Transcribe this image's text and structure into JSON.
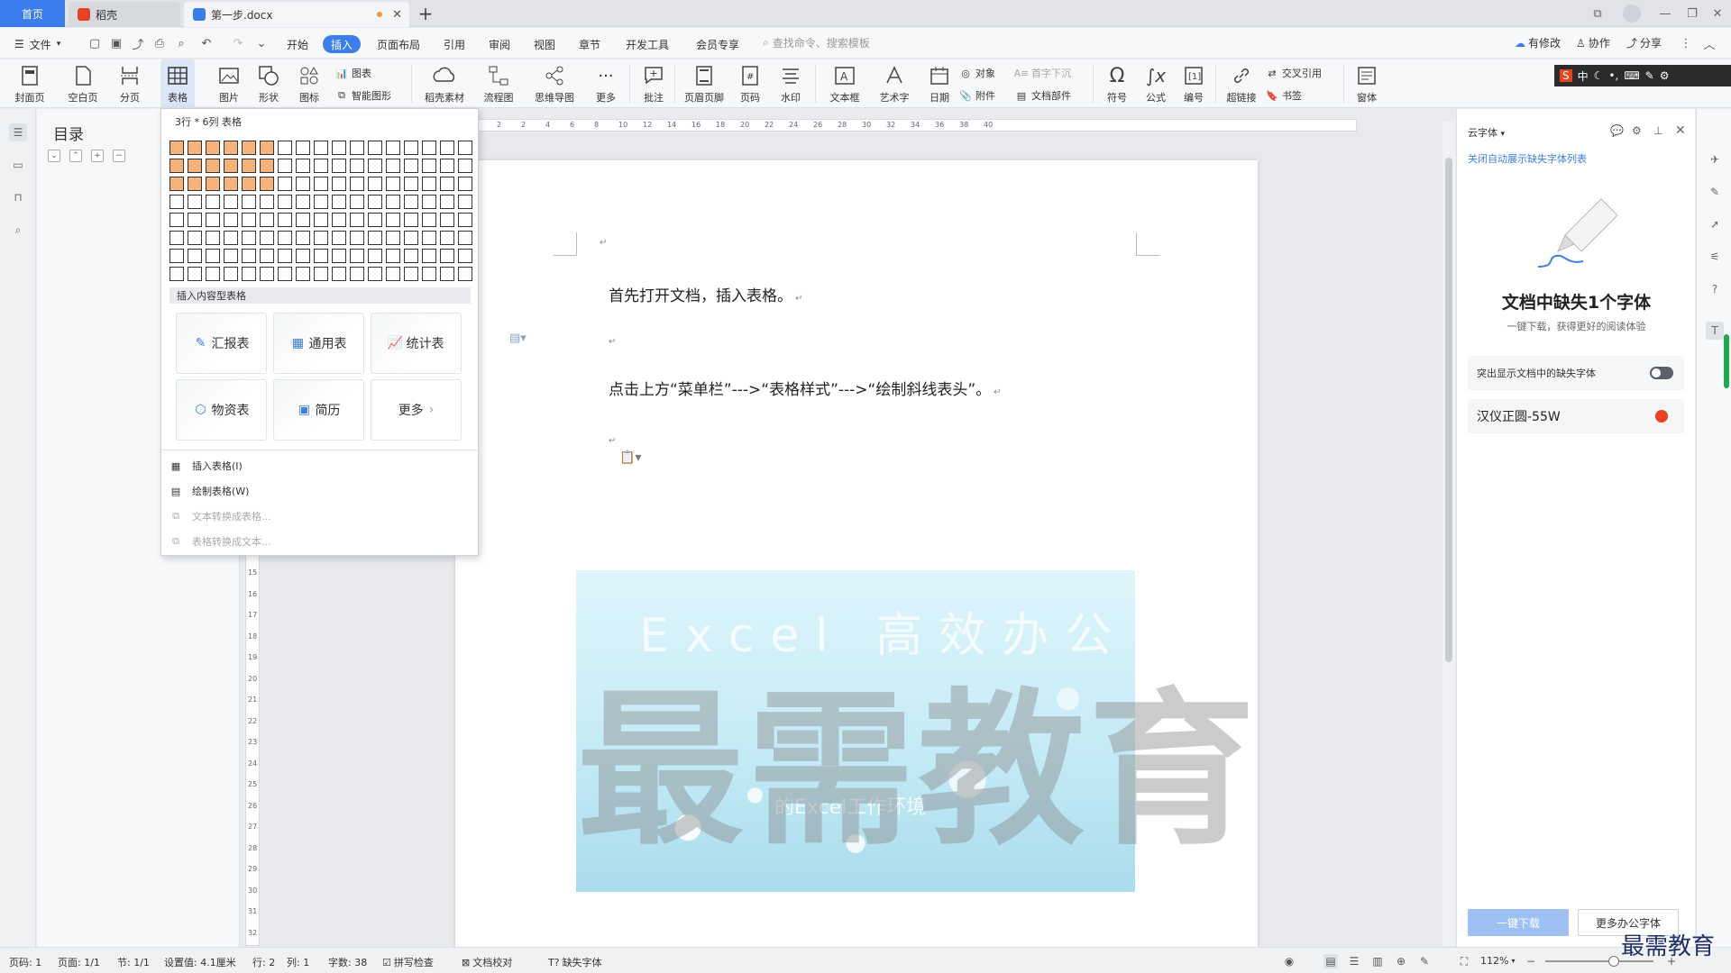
{
  "tabs": {
    "home": "首页",
    "daoke": "稻壳",
    "doc": "第一步.docx"
  },
  "menubar": {
    "file": "文件",
    "items": [
      "开始",
      "插入",
      "页面布局",
      "引用",
      "审阅",
      "视图",
      "章节",
      "开发工具",
      "会员专享"
    ],
    "search_placeholder": "查找命令、搜索模板",
    "changes": "有修改",
    "collab": "协作",
    "share": "分享"
  },
  "ribbon": {
    "cover": "封面页",
    "blank": "空白页",
    "pagebreak": "分页",
    "table": "表格",
    "picture": "图片",
    "shape": "形状",
    "icon": "图标",
    "chart": "图表",
    "smartart": "智能图形",
    "daoke": "稻壳素材",
    "flow": "流程图",
    "mind": "思维导图",
    "more": "更多",
    "comment": "批注",
    "header": "页眉页脚",
    "pagenum": "页码",
    "watermark": "水印",
    "textbox": "文本框",
    "wordart": "艺术字",
    "date": "日期",
    "object": "对象",
    "attach": "附件",
    "dropcap": "首字下沉",
    "docpart": "文档部件",
    "symbol": "符号",
    "formula": "公式",
    "numbering": "编号",
    "hyperlink": "超链接",
    "crossref": "交叉引用",
    "bookmark": "书签",
    "window": "窗体"
  },
  "ime": {
    "label": "中"
  },
  "toc": {
    "title": "目录"
  },
  "dropdown": {
    "grid_label": "3行 * 6列 表格",
    "grid_rows": 8,
    "grid_cols": 17,
    "selected_rows": 3,
    "selected_cols": 6,
    "section_header": "插入内容型表格",
    "cards": [
      "汇报表",
      "通用表",
      "统计表",
      "物资表",
      "简历",
      "更多"
    ],
    "menu": [
      {
        "label": "插入表格(I)",
        "enabled": true
      },
      {
        "label": "绘制表格(W)",
        "enabled": true
      },
      {
        "label": "文本转换成表格...",
        "enabled": false
      },
      {
        "label": "表格转换成文本...",
        "enabled": false
      }
    ]
  },
  "document": {
    "para1": "首先打开文档，插入表格。",
    "para2": "点击上方“菜单栏”--->“表格样式”--->“绘制斜线表头”。",
    "image_title": "Excel 高效办公",
    "image_sub": "的Excel工作环境",
    "watermark": "最需教育"
  },
  "ruler_h": [
    "4",
    "2",
    "2",
    "4",
    "6",
    "8",
    "10",
    "12",
    "14",
    "16",
    "18",
    "20",
    "22",
    "24",
    "26",
    "28",
    "30",
    "32",
    "34",
    "36",
    "38",
    "40"
  ],
  "ruler_v": [
    "15",
    "16",
    "17",
    "18",
    "19",
    "20",
    "21",
    "22",
    "23",
    "24",
    "25",
    "26",
    "27",
    "28",
    "29",
    "30",
    "31",
    "32"
  ],
  "rightpanel": {
    "title": "云字体",
    "link": "关闭自动展示缺失字体列表",
    "heading": "文档中缺失1个字体",
    "subheading": "一键下载，获得更好的阅读体验",
    "toggle_label": "突出显示文档中的缺失字体",
    "font": "汉仪正圆-55W",
    "download": "一键下载",
    "more": "更多办公字体"
  },
  "status": {
    "page": "页码: 1",
    "pages": "页面: 1/1",
    "section": "节: 1/1",
    "setting": "设置值: 4.1厘米",
    "row": "行: 2",
    "col": "列: 1",
    "words": "字数: 38",
    "spell": "拼写检查",
    "proof": "文档校对",
    "missing": "缺失字体",
    "zoom": "112%"
  },
  "brand": "最需教育",
  "colors": {
    "accent": "#3b7ded",
    "grid_selected": "#f7b27a",
    "missing_badge": "#e8421f"
  }
}
